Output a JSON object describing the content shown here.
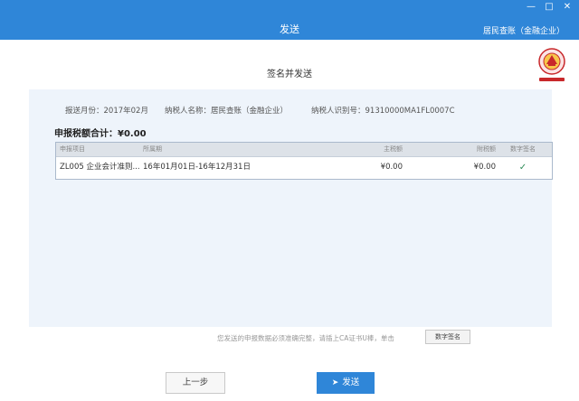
{
  "window": {
    "title": "发送",
    "user_label": "居民查账（金融企业）",
    "controls": {
      "minimize": "—",
      "maximize": "□",
      "close": "✕"
    }
  },
  "page": {
    "title": "签名并发送"
  },
  "emblem": {
    "icon": "tax-bureau-emblem-icon",
    "color": "#c8282b"
  },
  "info": {
    "report_month": "报送月份：2017年02月",
    "taxpayer_name": "纳税人名称：居民查账（金融企业）",
    "taxpayer_id": "纳税人识别号：91310000MA1FL0007C"
  },
  "total": {
    "label": "申报税额合计：",
    "amount": "¥0.00"
  },
  "table": {
    "headers": {
      "item": "申报项目",
      "period": "所属期",
      "main_tax": "主税额",
      "addl_tax": "附税额",
      "signature": "数字签名"
    },
    "rows": [
      {
        "item": "ZL005 企业会计准则...",
        "period": "16年01月01日-16年12月31日",
        "main_tax": "¥0.00",
        "addl_tax": "¥0.00",
        "signature": "✓"
      }
    ]
  },
  "hint": "您发送的申报数据必须准确完整，请插上CA证书U棒，单击",
  "buttons": {
    "digital_sign": "数字签名",
    "prev": "上一步",
    "send": "发送"
  },
  "colors": {
    "accent": "#2f86d8",
    "panel": "#eef4fb",
    "check": "#2e8b57"
  }
}
